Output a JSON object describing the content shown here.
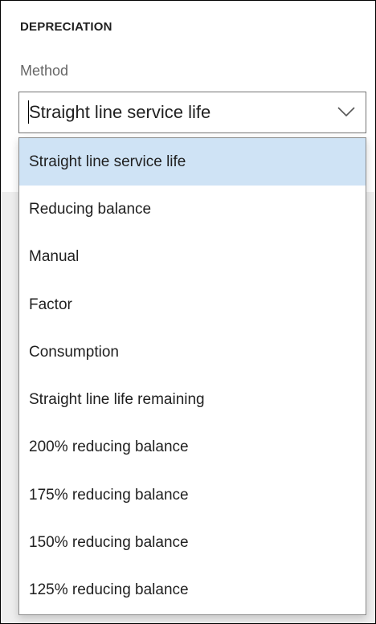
{
  "section": {
    "title": "DEPRECIATION"
  },
  "field": {
    "label": "Method",
    "selected_value": "Straight line service life"
  },
  "options": [
    "Straight line service life",
    "Reducing balance",
    "Manual",
    "Factor",
    "Consumption",
    "Straight line life remaining",
    "200% reducing balance",
    "175% reducing balance",
    "150% reducing balance",
    "125% reducing balance"
  ],
  "selected_index": 0,
  "icons": {
    "dropdown": "chevron-down-icon"
  },
  "colors": {
    "highlight": "#cfe3f5",
    "background_gray": "#eeeeee",
    "text": "#1f1f1f"
  }
}
